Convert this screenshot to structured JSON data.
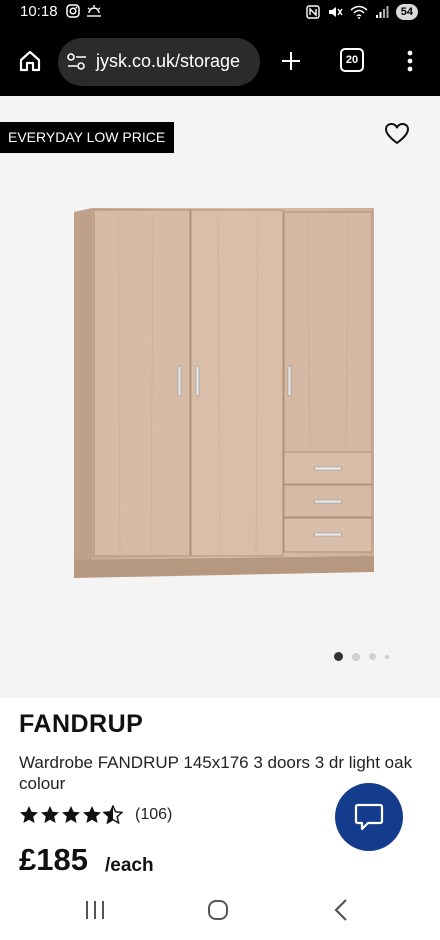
{
  "status_bar": {
    "time": "10:18",
    "battery": "54",
    "icons": [
      "instagram-icon",
      "weather-icon",
      "nfc-icon",
      "mute-icon",
      "wifi-icon",
      "signal-icon",
      "battery-icon"
    ]
  },
  "browser": {
    "url": "jysk.co.uk/storage",
    "tab_count": "20",
    "icons": [
      "home-icon",
      "site-settings-icon",
      "plus-icon",
      "tab-switcher-icon",
      "more-vert-icon"
    ]
  },
  "product": {
    "badge": "EVERYDAY LOW PRICE",
    "brand": "FANDRUP",
    "description": "Wardrobe FANDRUP 145x176 3 doors 3 dr light oak colour",
    "rating": 4.5,
    "review_count": "(106)",
    "price": "£185",
    "price_unit": "/each",
    "image_count": 4,
    "active_image": 1
  },
  "colors": {
    "chat_button": "#143c8c",
    "image_background": "#f4f4f4",
    "badge_background": "#000000",
    "wood": "#d2b49f"
  }
}
